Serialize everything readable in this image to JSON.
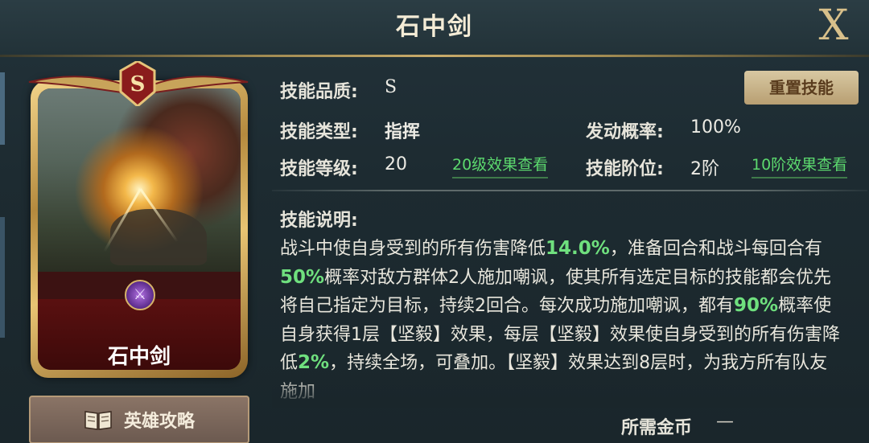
{
  "header": {
    "title": "石中剑",
    "close_label": "X"
  },
  "card": {
    "name": "石中剑",
    "quality_badge": "S"
  },
  "guide_button": {
    "label": "英雄攻略",
    "icon": "book-icon"
  },
  "reset_button": {
    "label": "重置技能"
  },
  "info": {
    "quality_label": "技能品质:",
    "quality_value": "S",
    "type_label": "技能类型:",
    "type_value": "指挥",
    "level_label": "技能等级:",
    "level_value": "20",
    "level_link": "20级效果查看",
    "trigger_label": "发动概率:",
    "trigger_value": "100%",
    "tier_label": "技能阶位:",
    "tier_value": "2阶",
    "tier_link": "10阶效果查看"
  },
  "description": {
    "label": "技能说明:",
    "p1": "战斗中使自身受到的所有伤害降低",
    "h1": "14.0%",
    "p2": "，准备回合和战斗每回合有",
    "h2": "50%",
    "p3": "概率对敌方群体2人施加嘲讽，使其所有选定目标的技能都会优先将自己指定为目标，持续2回合。每次成功施加嘲讽，都有",
    "h3": "90%",
    "p4": "概率使自身获得1层【坚毅】效果，每层【坚毅】效果使自身受到的所有伤害降低",
    "h4": "2%",
    "p5": "，持续全场，可叠加。【坚毅】效果达到8层时，为我方所有队友施加"
  },
  "cost": {
    "label": "所需金币",
    "value": "—"
  },
  "colors": {
    "highlight": "#6fe07e",
    "gold": "#c8ab6a",
    "button": "#c8b48a"
  }
}
